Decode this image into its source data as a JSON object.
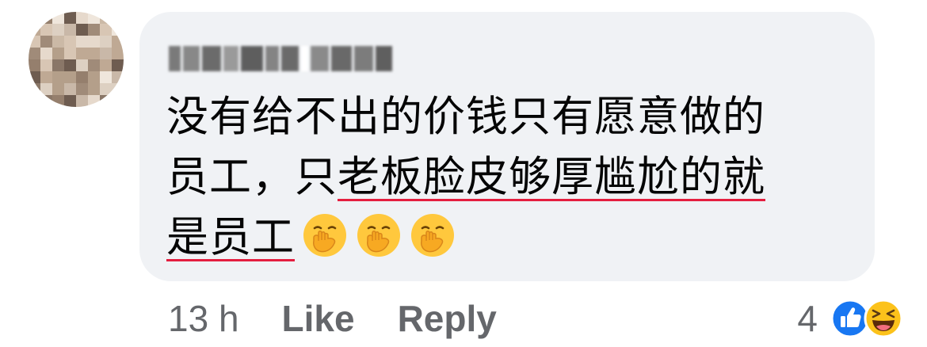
{
  "comment": {
    "lines": [
      [
        {
          "text": "没有给不出的价钱只有愿意做的",
          "underline": false
        }
      ],
      [
        {
          "text": "员工，只",
          "underline": false
        },
        {
          "text": "老板脸皮够厚尴尬的就",
          "underline": true
        }
      ],
      [
        {
          "text": "是员工",
          "underline": true
        }
      ]
    ],
    "emoji_count": 3,
    "emoji": "face-with-hand-over-mouth",
    "underline_color": "#e41e3f"
  },
  "meta": {
    "time": "13 h",
    "like_label": "Like",
    "reply_label": "Reply"
  },
  "reactions": {
    "count": "4",
    "types": [
      "like-icon",
      "haha-icon"
    ],
    "like_color": "#1877f2"
  }
}
